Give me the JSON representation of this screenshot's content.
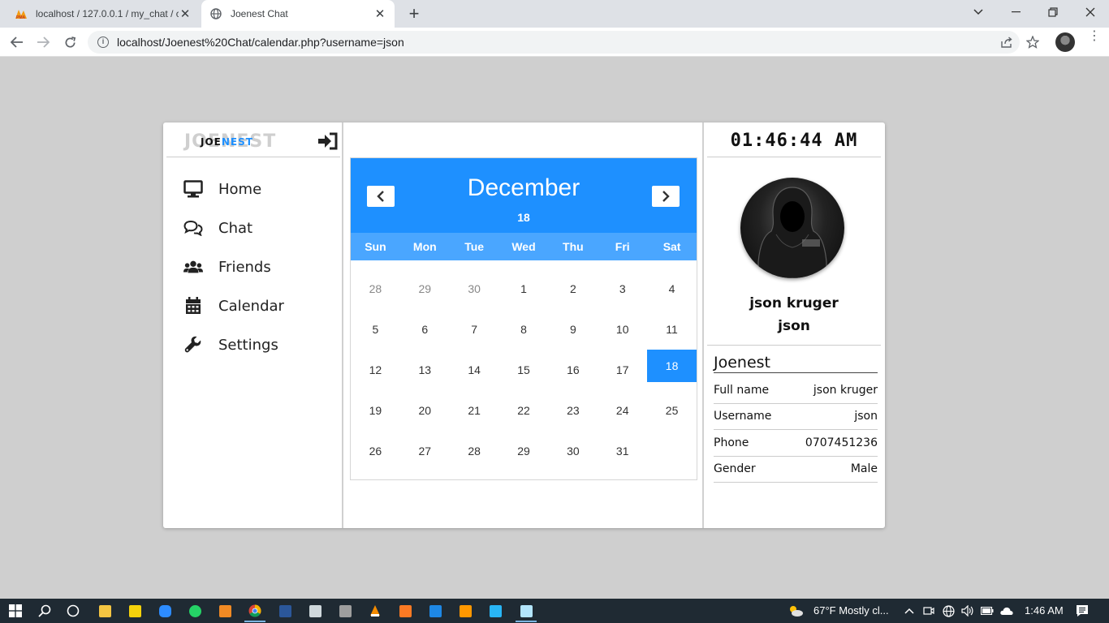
{
  "browser": {
    "tabs": [
      {
        "title": "localhost / 127.0.0.1 / my_chat / c",
        "icon": "phpmyadmin-icon",
        "active": false
      },
      {
        "title": "Joenest Chat",
        "icon": "globe-icon",
        "active": true
      }
    ],
    "url": "localhost/Joenest%20Chat/calendar.php?username=json"
  },
  "app": {
    "logo_shadow": "JOENEST",
    "logo_part1": "JOE",
    "logo_part2": "NEST",
    "accent": "#1e90ff",
    "nav": [
      {
        "label": "Home",
        "icon": "monitor-icon"
      },
      {
        "label": "Chat",
        "icon": "chat-bubbles-icon"
      },
      {
        "label": "Friends",
        "icon": "users-icon"
      },
      {
        "label": "Calendar",
        "icon": "calendar-icon"
      },
      {
        "label": "Settings",
        "icon": "wrench-icon"
      }
    ]
  },
  "calendar": {
    "month": "December",
    "selected_day": "18",
    "weekdays": [
      "Sun",
      "Mon",
      "Tue",
      "Wed",
      "Thu",
      "Fri",
      "Sat"
    ],
    "days": [
      {
        "d": "28",
        "muted": true
      },
      {
        "d": "29",
        "muted": true
      },
      {
        "d": "30",
        "muted": true
      },
      {
        "d": "1"
      },
      {
        "d": "2"
      },
      {
        "d": "3"
      },
      {
        "d": "4"
      },
      {
        "d": "5"
      },
      {
        "d": "6"
      },
      {
        "d": "7"
      },
      {
        "d": "8"
      },
      {
        "d": "9"
      },
      {
        "d": "10"
      },
      {
        "d": "11"
      },
      {
        "d": "12"
      },
      {
        "d": "13"
      },
      {
        "d": "14"
      },
      {
        "d": "15"
      },
      {
        "d": "16"
      },
      {
        "d": "17"
      },
      {
        "d": "18",
        "active": true
      },
      {
        "d": "19"
      },
      {
        "d": "20"
      },
      {
        "d": "21"
      },
      {
        "d": "22"
      },
      {
        "d": "23"
      },
      {
        "d": "24"
      },
      {
        "d": "25"
      },
      {
        "d": "26"
      },
      {
        "d": "27"
      },
      {
        "d": "28"
      },
      {
        "d": "29"
      },
      {
        "d": "30"
      },
      {
        "d": "31"
      }
    ]
  },
  "profile": {
    "clock": "01:46:44 AM",
    "full_name": "json kruger",
    "username": "json",
    "section_title": "Joenest",
    "fields": [
      {
        "label": "Full name",
        "value": "json kruger"
      },
      {
        "label": "Username",
        "value": "json"
      },
      {
        "label": "Phone",
        "value": "0707451236"
      },
      {
        "label": "Gender",
        "value": "Male"
      }
    ]
  },
  "taskbar": {
    "weather": "67°F  Mostly cl...",
    "time": "1:46 AM"
  }
}
